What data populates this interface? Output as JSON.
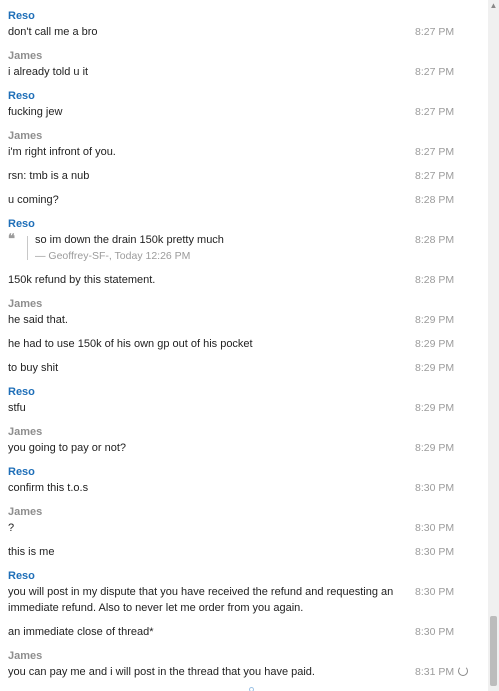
{
  "messages": [
    {
      "sender": "Reso",
      "lines": [
        {
          "text": "don't call me a bro",
          "time": "8:27 PM"
        }
      ]
    },
    {
      "sender": "James",
      "lines": [
        {
          "text": "i already told u it",
          "time": "8:27 PM"
        }
      ]
    },
    {
      "sender": "Reso",
      "lines": [
        {
          "text": "fucking jew",
          "time": "8:27 PM"
        }
      ]
    },
    {
      "sender": "James",
      "lines": [
        {
          "text": "i'm right infront of you.",
          "time": "8:27 PM"
        },
        {
          "text": "rsn: tmb is a nub",
          "time": "8:27 PM"
        },
        {
          "text": "u coming?",
          "time": "8:28 PM"
        }
      ]
    },
    {
      "sender": "Reso",
      "quote": {
        "text": "so im down the drain 150k pretty much",
        "source": "— Geoffrey-SF-, Today 12:26 PM",
        "time": "8:28 PM",
        "icon": "quote-icon"
      },
      "lines": [
        {
          "text": "150k refund by this statement.",
          "time": "8:28 PM"
        }
      ]
    },
    {
      "sender": "James",
      "lines": [
        {
          "text": "he said that.",
          "time": "8:29 PM"
        },
        {
          "text": "he had to use 150k of his own gp out of his pocket",
          "time": "8:29 PM"
        },
        {
          "text": "to buy shit",
          "time": "8:29 PM"
        }
      ]
    },
    {
      "sender": "Reso",
      "lines": [
        {
          "text": "stfu",
          "time": "8:29 PM"
        }
      ]
    },
    {
      "sender": "James",
      "lines": [
        {
          "text": "you going to pay or not?",
          "time": "8:29 PM"
        }
      ]
    },
    {
      "sender": "Reso",
      "lines": [
        {
          "text": "confirm this t.o.s",
          "time": "8:30 PM"
        }
      ]
    },
    {
      "sender": "James",
      "lines": [
        {
          "text": "?",
          "time": "8:30 PM"
        },
        {
          "text": "this is me",
          "time": "8:30 PM"
        }
      ]
    },
    {
      "sender": "Reso",
      "multiline": {
        "text": "you will post in my dispute that you have received the refund and requesting an immediate refund. Also to never let me order from you again.",
        "time": "8:30 PM"
      },
      "lines": [
        {
          "text": "an immediate close of thread*",
          "time": "8:30 PM"
        }
      ]
    },
    {
      "sender": "James",
      "lines": [
        {
          "text": "you can pay me and i will post in the thread that you have paid.",
          "time": "8:31 PM"
        }
      ]
    }
  ],
  "colors": {
    "reso": "#1f6fb8",
    "james": "#8e8e8e",
    "time": "#9b9b9b"
  },
  "scrollbar": {
    "icon": "chevron-up-icon"
  },
  "status": {
    "icon": "loading-spinner-icon"
  }
}
